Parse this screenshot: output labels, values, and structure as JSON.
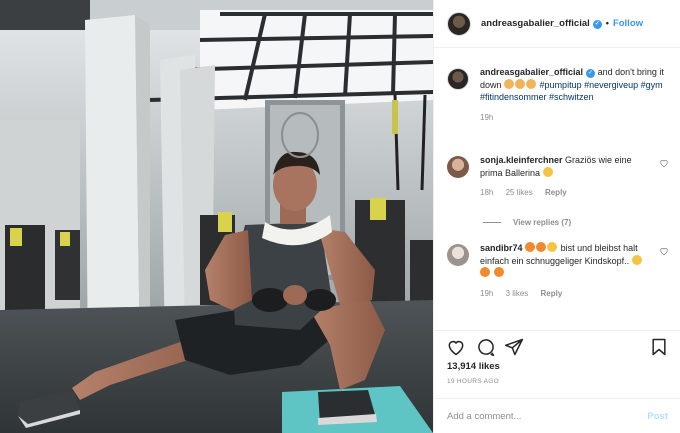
{
  "post": {
    "username": "andreasgabalier_official",
    "follow_label": "Follow",
    "separator": "•"
  },
  "caption": {
    "username": "andreasgabalier_official",
    "text": "and don't bring it down",
    "emojis": [
      "flexed-biceps",
      "flexed-biceps",
      "waving-hand"
    ],
    "hashtags": [
      "#pumpitup",
      "#nevergiveup",
      "#gym",
      "#fitindensommer",
      "#schwitzen"
    ],
    "age": "19h"
  },
  "comments": [
    {
      "username": "sonja.kleinferchner",
      "text": "Graziös wie eine prima Ballerina",
      "emoji_after": "grinning-face",
      "age": "18h",
      "likes": "25 likes",
      "reply_label": "Reply",
      "view_replies": "View replies (7)"
    },
    {
      "username": "sandibr74",
      "text_line1": "bist und bleibst halt einfach ein schnuggeliger Kindskopf..",
      "age": "19h",
      "likes": "3 likes",
      "reply_label": "Reply"
    }
  ],
  "stats": {
    "likes": "13,914 likes",
    "timestamp": "19 HOURS AGO"
  },
  "composer": {
    "placeholder": "Add a comment...",
    "post_label": "Post"
  },
  "colors": {
    "link_blue": "#3897f0",
    "hashtag": "#003569",
    "muted": "#8e8e8e",
    "mat": "#5fc4c4"
  }
}
